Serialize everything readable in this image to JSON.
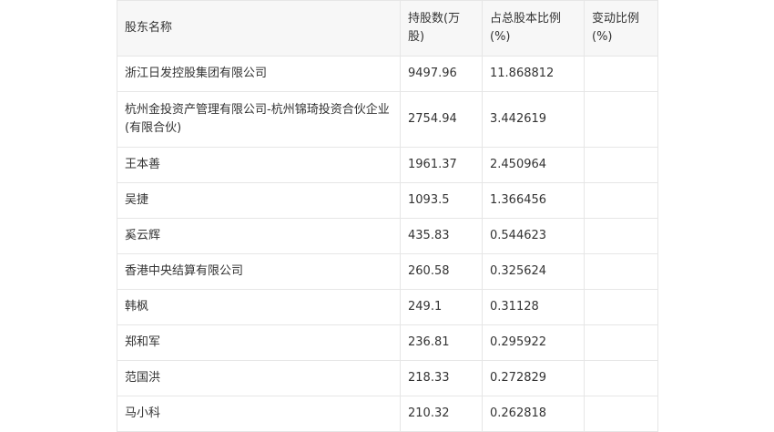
{
  "table": {
    "headers": [
      "股东名称",
      "持股数(万股)",
      "占总股本比例(%)",
      "变动比例(%)"
    ],
    "rows": [
      {
        "name": "浙江日发控股集团有限公司",
        "shares": "9497.96",
        "ratio": "11.868812",
        "change": ""
      },
      {
        "name": "杭州金投资产管理有限公司-杭州锦琦投资合伙企业(有限合伙)",
        "shares": "2754.94",
        "ratio": "3.442619",
        "change": ""
      },
      {
        "name": "王本善",
        "shares": "1961.37",
        "ratio": "2.450964",
        "change": ""
      },
      {
        "name": "吴捷",
        "shares": "1093.5",
        "ratio": "1.366456",
        "change": ""
      },
      {
        "name": "奚云辉",
        "shares": "435.83",
        "ratio": "0.544623",
        "change": ""
      },
      {
        "name": "香港中央结算有限公司",
        "shares": "260.58",
        "ratio": "0.325624",
        "change": ""
      },
      {
        "name": "韩枫",
        "shares": "249.1",
        "ratio": "0.31128",
        "change": ""
      },
      {
        "name": "郑和军",
        "shares": "236.81",
        "ratio": "0.295922",
        "change": ""
      },
      {
        "name": "范国洪",
        "shares": "218.33",
        "ratio": "0.272829",
        "change": ""
      },
      {
        "name": "马小科",
        "shares": "210.32",
        "ratio": "0.262818",
        "change": ""
      }
    ]
  }
}
